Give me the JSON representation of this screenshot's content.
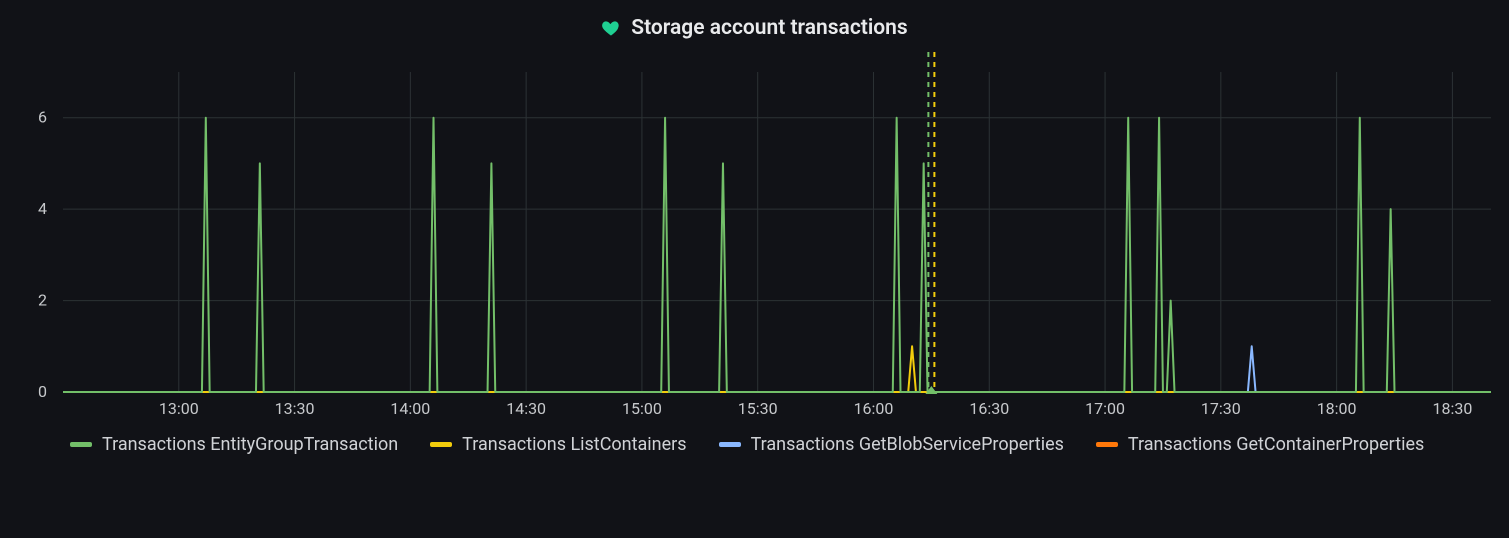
{
  "panel": {
    "title": "Storage account transactions",
    "health_icon": "heart-icon",
    "health_color": "#1fcf92"
  },
  "legend": [
    {
      "label": "Transactions EntityGroupTransaction",
      "color": "#73bf69"
    },
    {
      "label": "Transactions ListContainers",
      "color": "#f2cc0c"
    },
    {
      "label": "Transactions GetBlobServiceProperties",
      "color": "#8ab8ff"
    },
    {
      "label": "Transactions GetContainerProperties",
      "color": "#ff780a"
    }
  ],
  "chart_data": {
    "type": "line",
    "title": "Storage account transactions",
    "xlabel": "",
    "ylabel": "",
    "x_type": "time",
    "x_range_min": 750,
    "x_range_max": 1120,
    "x_tick_step": 30,
    "x_tick_labels": [
      "13:00",
      "13:30",
      "14:00",
      "14:30",
      "15:00",
      "15:30",
      "16:00",
      "16:30",
      "17:00",
      "17:30",
      "18:00",
      "18:30"
    ],
    "ylim": [
      0,
      7
    ],
    "y_ticks": [
      0,
      2,
      4,
      6
    ],
    "annotation_x": 975,
    "series": [
      {
        "name": "Transactions EntityGroupTransaction",
        "color": "#73bf69",
        "x": [
          750,
          786,
          787,
          788,
          800,
          801,
          802,
          845,
          846,
          847,
          848,
          860,
          861,
          862,
          905,
          906,
          907,
          908,
          920,
          921,
          922,
          965,
          966,
          967,
          968,
          972,
          973,
          974,
          1025,
          1026,
          1027,
          1028,
          1033,
          1034,
          1035,
          1036,
          1037,
          1038,
          1085,
          1086,
          1087,
          1088,
          1093,
          1094,
          1095,
          1120
        ],
        "values": [
          0,
          0,
          6,
          0,
          0,
          5,
          0,
          0,
          6,
          0,
          0,
          0,
          5,
          0,
          0,
          6,
          0,
          0,
          0,
          5,
          0,
          0,
          6,
          0,
          0,
          0,
          5,
          0,
          0,
          6,
          0,
          0,
          0,
          6,
          0,
          0,
          2,
          0,
          0,
          6,
          0,
          0,
          0,
          4,
          0,
          0
        ]
      },
      {
        "name": "Transactions ListContainers",
        "color": "#f2cc0c",
        "x": [
          750,
          969,
          970,
          971,
          1120
        ],
        "values": [
          0,
          0,
          1,
          0,
          0
        ]
      },
      {
        "name": "Transactions GetBlobServiceProperties",
        "color": "#8ab8ff",
        "x": [
          750,
          1057,
          1058,
          1059,
          1120
        ],
        "values": [
          0,
          0,
          1,
          0,
          0
        ]
      },
      {
        "name": "Transactions GetContainerProperties",
        "color": "#ff780a",
        "x": [
          750,
          1120
        ],
        "values": [
          0,
          0
        ]
      }
    ]
  }
}
